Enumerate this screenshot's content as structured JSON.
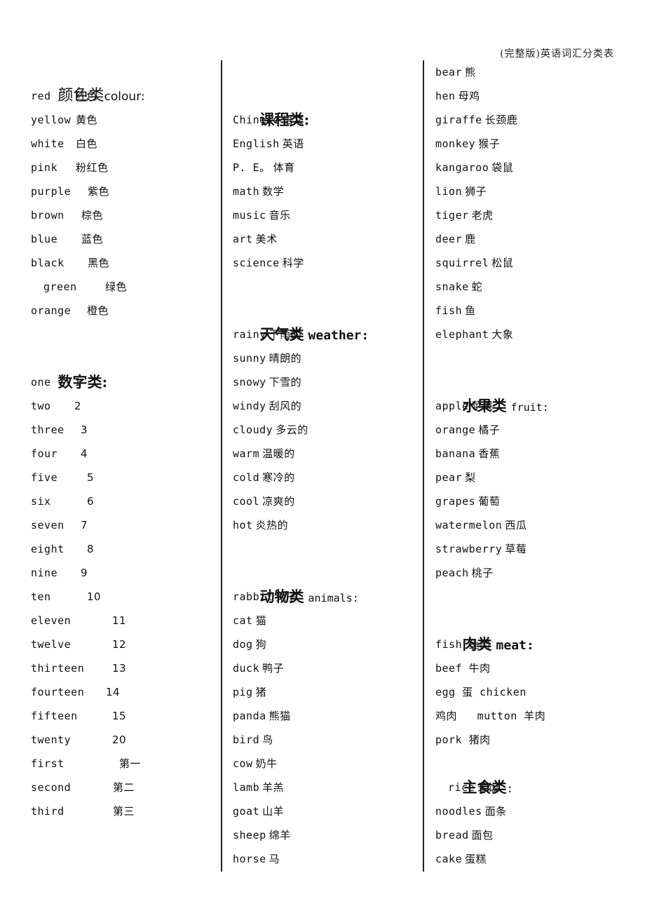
{
  "header": {
    "title": "(完整版)英语词汇分类表"
  },
  "colours": {
    "heading_zh": "颜色类",
    "heading_en": "colour:",
    "items": [
      {
        "en": "red",
        "zh": "红色"
      },
      {
        "en": "yellow",
        "zh": "黄色"
      },
      {
        "en": "white",
        "zh": "白色"
      },
      {
        "en": "pink",
        "zh": "粉红色"
      },
      {
        "en": "purple",
        "zh": "紫色"
      },
      {
        "en": "brown",
        "zh": "棕色"
      },
      {
        "en": "blue",
        "zh": "蓝色"
      },
      {
        "en": "black",
        "zh": "黑色"
      },
      {
        "en": "green",
        "zh": "绿色"
      },
      {
        "en": "orange",
        "zh": "橙色"
      }
    ]
  },
  "numbers": {
    "heading_zh": "数字类:",
    "items": [
      {
        "en": "one",
        "zh": "1"
      },
      {
        "en": "two",
        "zh": "2"
      },
      {
        "en": "three",
        "zh": "3"
      },
      {
        "en": "four",
        "zh": "4"
      },
      {
        "en": "five",
        "zh": "5"
      },
      {
        "en": "six",
        "zh": "6"
      },
      {
        "en": "seven",
        "zh": "7"
      },
      {
        "en": "eight",
        "zh": "8"
      },
      {
        "en": "nine",
        "zh": "9"
      },
      {
        "en": "ten",
        "zh": "10"
      },
      {
        "en": "eleven",
        "zh": "11"
      },
      {
        "en": "twelve",
        "zh": "12"
      },
      {
        "en": "thirteen",
        "zh": "13"
      },
      {
        "en": "fourteen",
        "zh": "14"
      },
      {
        "en": "fifteen",
        "zh": "15"
      },
      {
        "en": "twenty",
        "zh": "20"
      },
      {
        "en": "first",
        "zh": "第一"
      },
      {
        "en": "second",
        "zh": "第二"
      },
      {
        "en": "third",
        "zh": "第三"
      }
    ]
  },
  "subjects": {
    "heading_zh": "课程类:",
    "items": [
      {
        "en": "Chinese",
        "zh": "语文"
      },
      {
        "en": "English",
        "zh": "英语"
      },
      {
        "en": "P. E。",
        "zh": "体育"
      },
      {
        "en": "math",
        "zh": "数学"
      },
      {
        "en": "music",
        "zh": "音乐"
      },
      {
        "en": "art",
        "zh": "美术"
      },
      {
        "en": "science",
        "zh": "科学"
      }
    ]
  },
  "weather": {
    "heading_zh": "天气类",
    "heading_en": "weather:",
    "items": [
      {
        "en": "rainy",
        "zh": "下雨的"
      },
      {
        "en": "sunny",
        "zh": "晴朗的"
      },
      {
        "en": "snowy",
        "zh": "下雪的"
      },
      {
        "en": "windy",
        "zh": "刮风的"
      },
      {
        "en": "cloudy",
        "zh": "多云的"
      },
      {
        "en": "warm",
        "zh": "温暖的"
      },
      {
        "en": "cold",
        "zh": "寒冷的"
      },
      {
        "en": "cool",
        "zh": "凉爽的"
      },
      {
        "en": "hot",
        "zh": "炎热的"
      }
    ]
  },
  "animals": {
    "heading_zh": "动物类",
    "heading_en": "animals:",
    "items": [
      {
        "en": "rabbit",
        "zh": "兔子"
      },
      {
        "en": "cat",
        "zh": "猫"
      },
      {
        "en": "dog",
        "zh": "狗"
      },
      {
        "en": "duck",
        "zh": "鸭子"
      },
      {
        "en": "pig",
        "zh": "猪"
      },
      {
        "en": "panda",
        "zh": "熊猫"
      },
      {
        "en": "bird",
        "zh": "鸟"
      },
      {
        "en": "cow",
        "zh": "奶牛"
      },
      {
        "en": "lamb",
        "zh": "羊羔"
      },
      {
        "en": "goat",
        "zh": "山羊"
      },
      {
        "en": "sheep",
        "zh": "绵羊"
      },
      {
        "en": "horse",
        "zh": "马"
      },
      {
        "en": "bear",
        "zh": "熊"
      },
      {
        "en": "hen",
        "zh": "母鸡"
      },
      {
        "en": "giraffe",
        "zh": "长颈鹿"
      },
      {
        "en": "monkey",
        "zh": "猴子"
      },
      {
        "en": "kangaroo",
        "zh": "袋鼠"
      },
      {
        "en": "lion",
        "zh": "狮子"
      },
      {
        "en": "tiger",
        "zh": "老虎"
      },
      {
        "en": "deer",
        "zh": "鹿"
      },
      {
        "en": "squirrel",
        "zh": "松鼠"
      },
      {
        "en": "snake",
        "zh": "蛇"
      },
      {
        "en": "fish",
        "zh": "鱼"
      },
      {
        "en": "elephant",
        "zh": "大象"
      }
    ]
  },
  "fruit": {
    "heading_zh": "水果类",
    "heading_en": "fruit:",
    "items": [
      {
        "en": "apple",
        "zh": "苹果"
      },
      {
        "en": "orange",
        "zh": "橘子"
      },
      {
        "en": "banana",
        "zh": "香蕉"
      },
      {
        "en": "pear",
        "zh": "梨"
      },
      {
        "en": "grapes",
        "zh": "葡萄"
      },
      {
        "en": "watermelon",
        "zh": "西瓜"
      },
      {
        "en": "strawberry",
        "zh": "草莓"
      },
      {
        "en": "peach",
        "zh": "桃子"
      }
    ]
  },
  "meat": {
    "heading_zh": "肉类",
    "heading_en": "meat:",
    "lines": [
      "fish 鱼肉",
      "beef 牛肉",
      "egg 蛋 chicken",
      "鸡肉   mutton 羊肉",
      "pork 猪肉"
    ]
  },
  "staple": {
    "heading_zh": "主食类",
    "heading_colon": ":",
    "items": [
      {
        "en": "rice",
        "zh": "米饭"
      },
      {
        "en": "noodles",
        "zh": "面条"
      },
      {
        "en": "bread",
        "zh": "面包"
      },
      {
        "en": "cake",
        "zh": "蛋糕"
      }
    ]
  }
}
